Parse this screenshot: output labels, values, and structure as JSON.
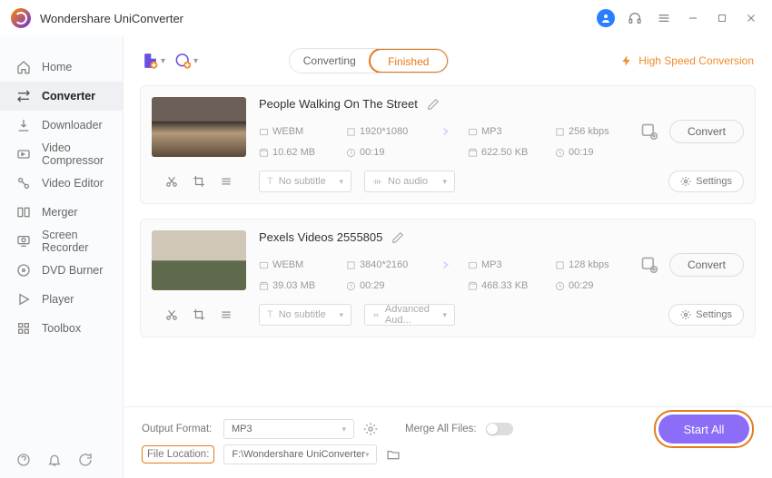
{
  "app": {
    "title": "Wondershare UniConverter"
  },
  "sidebar": {
    "items": [
      {
        "label": "Home"
      },
      {
        "label": "Converter"
      },
      {
        "label": "Downloader"
      },
      {
        "label": "Video Compressor"
      },
      {
        "label": "Video Editor"
      },
      {
        "label": "Merger"
      },
      {
        "label": "Screen Recorder"
      },
      {
        "label": "DVD Burner"
      },
      {
        "label": "Player"
      },
      {
        "label": "Toolbox"
      }
    ]
  },
  "tabs": {
    "converting": "Converting",
    "finished": "Finished"
  },
  "hispeed": "High Speed Conversion",
  "files": [
    {
      "title": "People Walking On The Street",
      "src_fmt": "WEBM",
      "src_res": "1920*1080",
      "src_size": "10.62 MB",
      "src_dur": "00:19",
      "dst_fmt": "MP3",
      "dst_bit": "256 kbps",
      "dst_size": "622.50 KB",
      "dst_dur": "00:19",
      "subtitle": "No subtitle",
      "audio": "No audio"
    },
    {
      "title": "Pexels Videos 2555805",
      "src_fmt": "WEBM",
      "src_res": "3840*2160",
      "src_size": "39.03 MB",
      "src_dur": "00:29",
      "dst_fmt": "MP3",
      "dst_bit": "128 kbps",
      "dst_size": "468.33 KB",
      "dst_dur": "00:29",
      "subtitle": "No subtitle",
      "audio": "Advanced Aud..."
    }
  ],
  "buttons": {
    "convert": "Convert",
    "settings": "Settings",
    "start_all": "Start All"
  },
  "bottom": {
    "output_format_label": "Output Format:",
    "output_format_value": "MP3",
    "file_location_label": "File Location:",
    "file_location_value": "F:\\Wondershare UniConverter",
    "merge_label": "Merge All Files:"
  }
}
